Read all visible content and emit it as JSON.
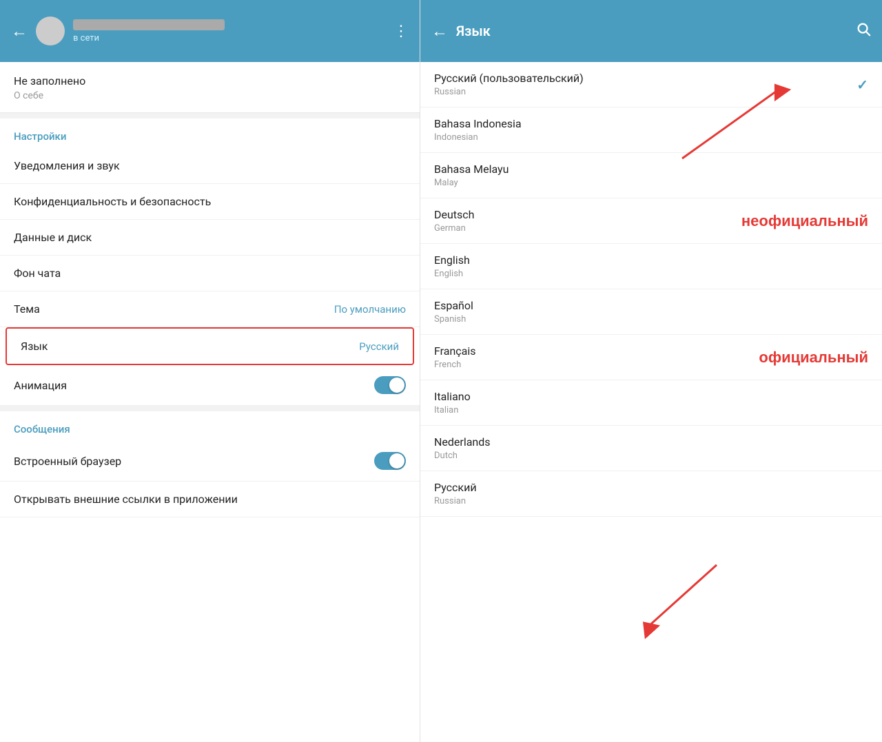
{
  "left": {
    "header": {
      "back_label": "←",
      "status": "в сети",
      "dots": "⋮",
      "name_placeholder": ""
    },
    "profile": {
      "not_filled": "Не заполнено",
      "about": "О себе"
    },
    "settings": {
      "section_label": "Настройки",
      "items": [
        {
          "label": "Уведомления и звук",
          "value": ""
        },
        {
          "label": "Конфиденциальность и безопасность",
          "value": ""
        },
        {
          "label": "Данные и диск",
          "value": ""
        },
        {
          "label": "Фон чата",
          "value": ""
        },
        {
          "label": "Тема",
          "value": "По умолчанию"
        },
        {
          "label": "Язык",
          "value": "Русский"
        },
        {
          "label": "Анимация",
          "value": ""
        }
      ]
    },
    "messages": {
      "section_label": "Сообщения",
      "items": [
        {
          "label": "Встроенный браузер",
          "value": ""
        },
        {
          "label": "Открывать внешние ссылки в приложении",
          "value": ""
        }
      ]
    }
  },
  "right": {
    "header": {
      "back_label": "←",
      "title": "Язык",
      "search_icon": "🔍"
    },
    "languages": [
      {
        "name": "Русский (пользовательский)",
        "native": "Russian",
        "selected": true,
        "annotation": ""
      },
      {
        "name": "Bahasa Indonesia",
        "native": "Indonesian",
        "selected": false,
        "annotation": "неофициальный"
      },
      {
        "name": "Bahasa Melayu",
        "native": "Malay",
        "selected": false,
        "annotation": ""
      },
      {
        "name": "Deutsch",
        "native": "German",
        "selected": false,
        "annotation": ""
      },
      {
        "name": "English",
        "native": "English",
        "selected": false,
        "annotation": ""
      },
      {
        "name": "Español",
        "native": "Spanish",
        "selected": false,
        "annotation": ""
      },
      {
        "name": "Français",
        "native": "French",
        "selected": false,
        "annotation": "официальный"
      },
      {
        "name": "Italiano",
        "native": "Italian",
        "selected": false,
        "annotation": ""
      },
      {
        "name": "Nederlands",
        "native": "Dutch",
        "selected": false,
        "annotation": ""
      },
      {
        "name": "Русский",
        "native": "Russian",
        "selected": false,
        "annotation": ""
      }
    ],
    "annotation_unofficial": "неофициальный",
    "annotation_official": "официальный"
  }
}
